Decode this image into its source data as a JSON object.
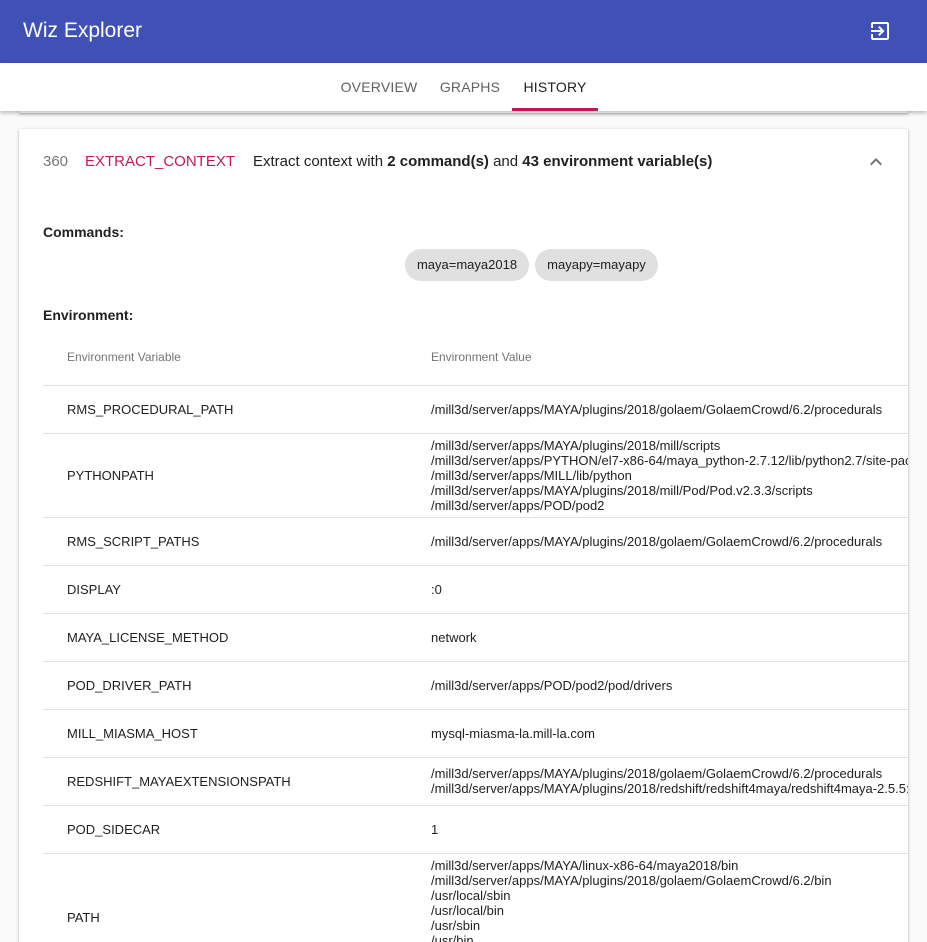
{
  "app": {
    "title": "Wiz Explorer",
    "logout_icon": "exit-to-app-icon"
  },
  "tabs": [
    {
      "label": "OVERVIEW"
    },
    {
      "label": "GRAPHS"
    },
    {
      "label": "HISTORY",
      "active": true
    }
  ],
  "colors": {
    "appbar": "#3f51b5",
    "accent": "#c2185b"
  },
  "step": {
    "number": "360",
    "name": "EXTRACT_CONTEXT",
    "desc_prefix": "Extract context with ",
    "desc_commands": "2 command(s)",
    "desc_and": " and ",
    "desc_env": "43 environment variable(s)",
    "collapse_icon": "chevron-up-icon"
  },
  "commands": {
    "label": "Commands:",
    "chips": [
      "maya=maya2018",
      "mayapy=mayapy"
    ]
  },
  "environment": {
    "label": "Environment:",
    "col_variable": "Environment Variable",
    "col_value": "Environment Value",
    "rows": [
      {
        "name": "RMS_PROCEDURAL_PATH",
        "values": [
          "/mill3d/server/apps/MAYA/plugins/2018/golaem/GolaemCrowd/6.2/procedurals"
        ]
      },
      {
        "name": "PYTHONPATH",
        "values": [
          "/mill3d/server/apps/MAYA/plugins/2018/mill/scripts",
          "/mill3d/server/apps/PYTHON/el7-x86-64/maya_python-2.7.12/lib/python2.7/site-pac",
          "/mill3d/server/apps/MILL/lib/python",
          "/mill3d/server/apps/MAYA/plugins/2018/mill/Pod/Pod.v2.3.3/scripts",
          "/mill3d/server/apps/POD/pod2"
        ]
      },
      {
        "name": "RMS_SCRIPT_PATHS",
        "values": [
          "/mill3d/server/apps/MAYA/plugins/2018/golaem/GolaemCrowd/6.2/procedurals"
        ]
      },
      {
        "name": "DISPLAY",
        "values": [
          ":0"
        ]
      },
      {
        "name": "MAYA_LICENSE_METHOD",
        "values": [
          "network"
        ]
      },
      {
        "name": "POD_DRIVER_PATH",
        "values": [
          "/mill3d/server/apps/POD/pod2/pod/drivers"
        ]
      },
      {
        "name": "MILL_MIASMA_HOST",
        "values": [
          "mysql-miasma-la.mill-la.com"
        ]
      },
      {
        "name": "REDSHIFT_MAYAEXTENSIONSPATH",
        "values": [
          "/mill3d/server/apps/MAYA/plugins/2018/golaem/GolaemCrowd/6.2/procedurals",
          "/mill3d/server/apps/MAYA/plugins/2018/redshift/redshift4maya/redshift4maya-2.5.5:"
        ]
      },
      {
        "name": "POD_SIDECAR",
        "values": [
          "1"
        ]
      },
      {
        "name": "PATH",
        "values": [
          "/mill3d/server/apps/MAYA/linux-x86-64/maya2018/bin",
          "/mill3d/server/apps/MAYA/plugins/2018/golaem/GolaemCrowd/6.2/bin",
          "/usr/local/sbin",
          "/usr/local/bin",
          "/usr/sbin",
          "/usr/bin"
        ]
      }
    ]
  }
}
